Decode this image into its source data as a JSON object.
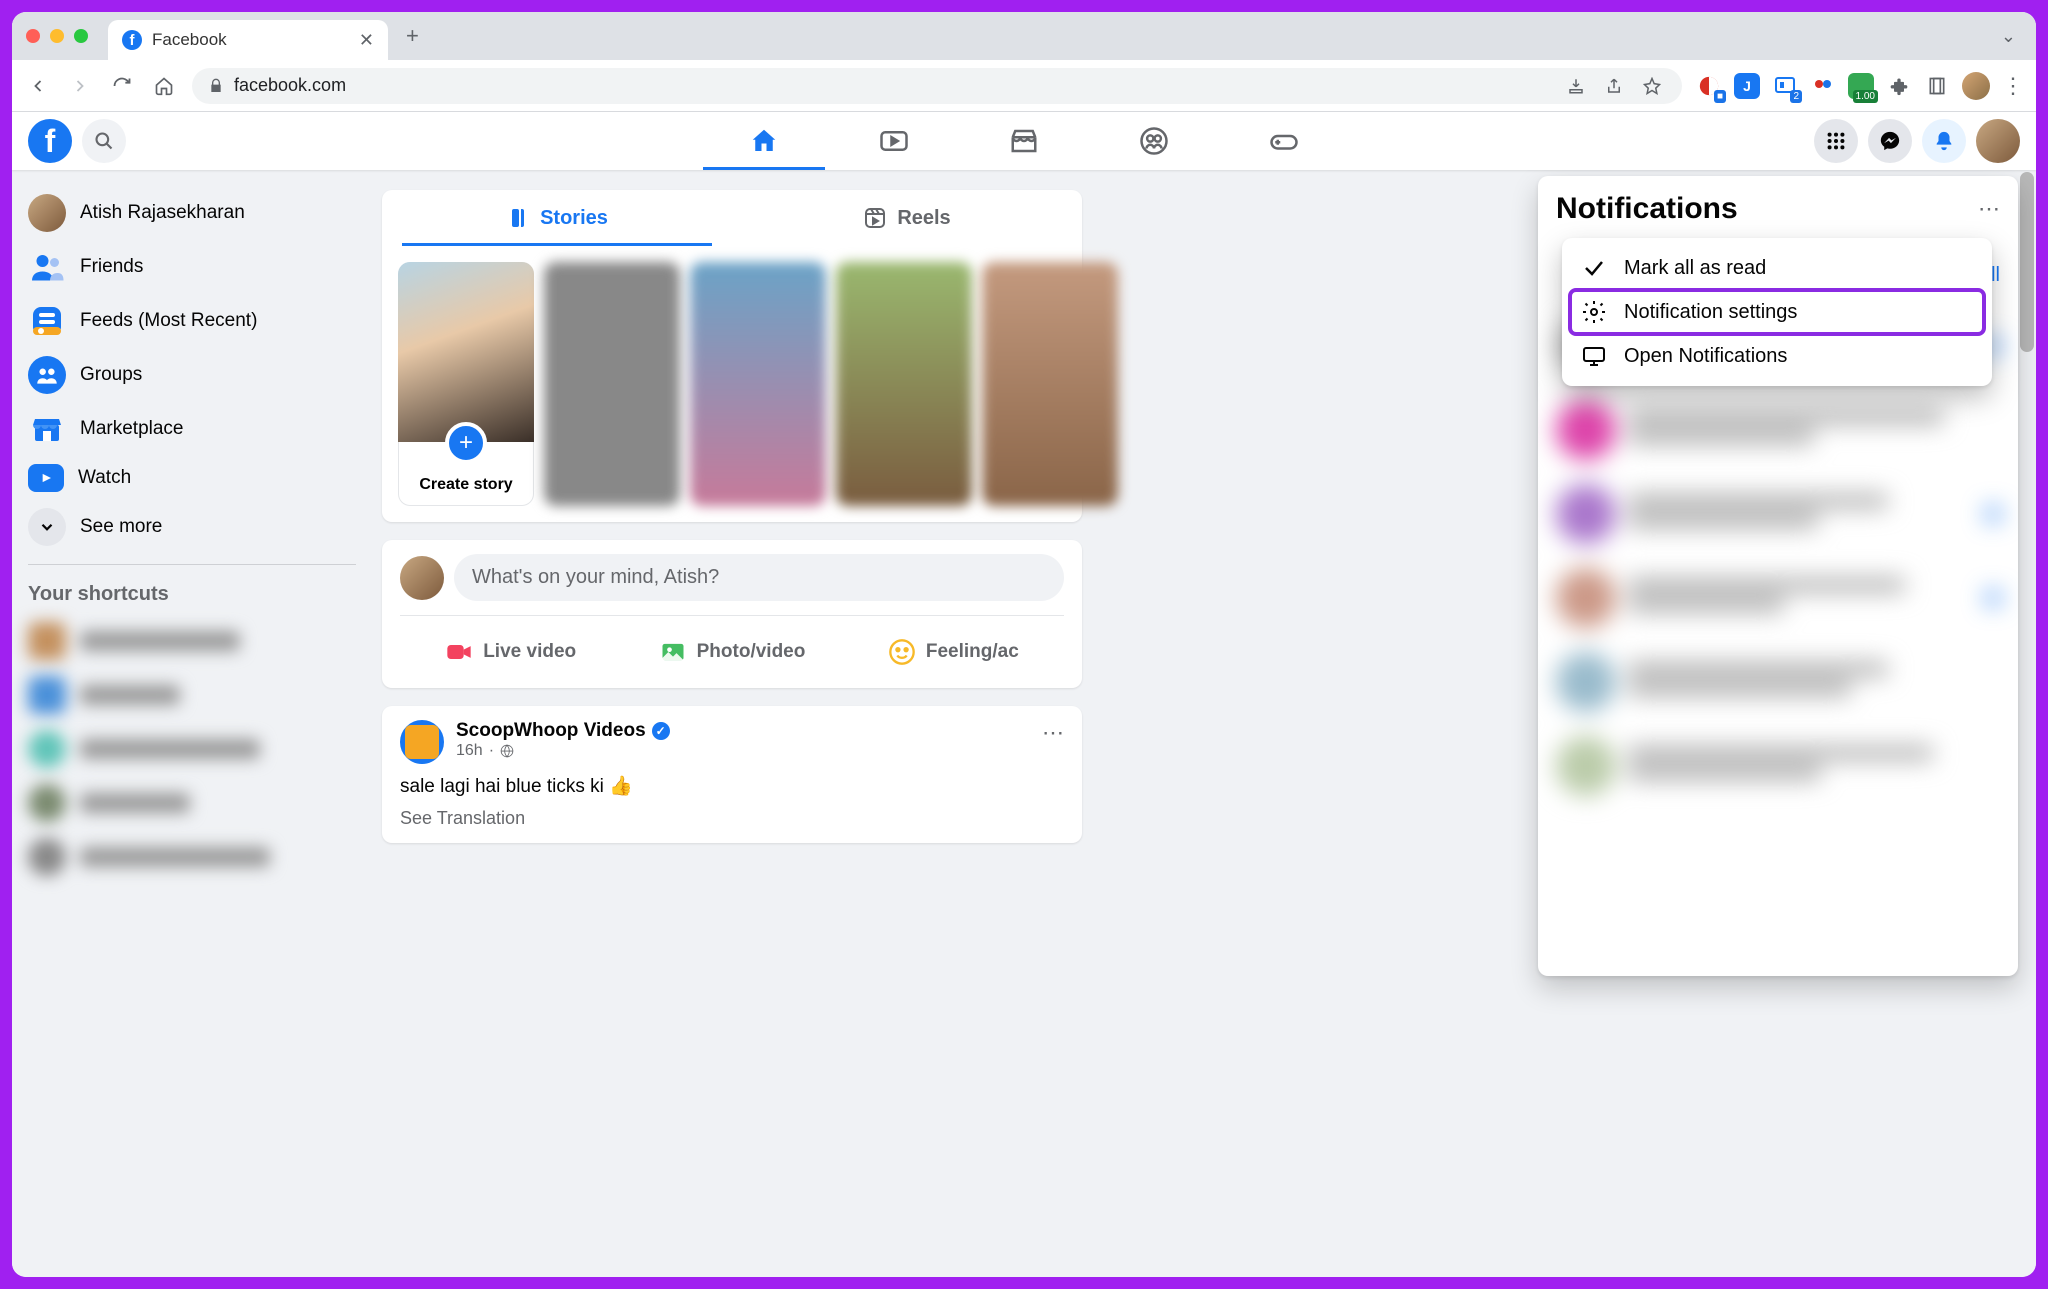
{
  "browser": {
    "tab_title": "Facebook",
    "url": "facebook.com"
  },
  "fb_header": {
    "nav": [
      "home",
      "watch",
      "marketplace",
      "groups",
      "gaming"
    ]
  },
  "left_sidebar": {
    "user_name": "Atish Rajasekharan",
    "items": {
      "friends": "Friends",
      "feeds": "Feeds (Most Recent)",
      "groups": "Groups",
      "marketplace": "Marketplace",
      "watch": "Watch",
      "see_more": "See more"
    },
    "shortcuts_heading": "Your shortcuts"
  },
  "stories": {
    "tab_stories": "Stories",
    "tab_reels": "Reels",
    "create_label": "Create story"
  },
  "compose": {
    "placeholder": "What's on your mind, Atish?",
    "live": "Live video",
    "photo": "Photo/video",
    "feeling": "Feeling/ac"
  },
  "post": {
    "author": "ScoopWhoop Videos",
    "time": "16h",
    "text": "sale lagi hai blue ticks ki 👍",
    "see_translation": "See Translation"
  },
  "notifications": {
    "title": "Notifications",
    "see_all": "all",
    "menu": {
      "mark_read": "Mark all as read",
      "settings": "Notification settings",
      "open": "Open Notifications"
    }
  }
}
